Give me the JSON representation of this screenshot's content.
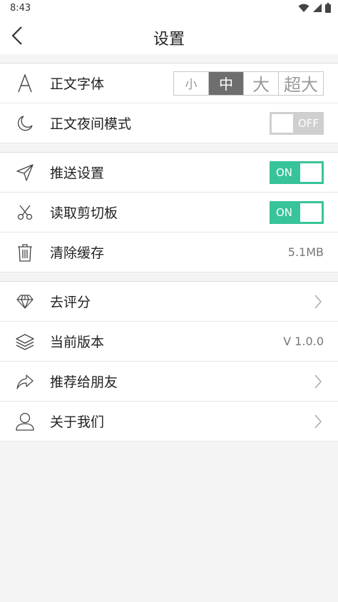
{
  "status_bar": {
    "time": "8:43",
    "icons": [
      "wifi-icon",
      "signal-icon",
      "battery-icon"
    ]
  },
  "header": {
    "title": "设置",
    "back_icon": "chevron-left-icon"
  },
  "colors": {
    "accent": "#38c49a",
    "toggle_off": "#cfcfcf",
    "segment_active": "#6e6e6e"
  },
  "groups": [
    {
      "items": [
        {
          "icon": "font-a-icon",
          "label": "正文字体",
          "control": "segment",
          "options": [
            "小",
            "中",
            "大",
            "超大"
          ],
          "selected": "中"
        },
        {
          "icon": "moon-icon",
          "label": "正文夜间模式",
          "control": "toggle",
          "state": "OFF"
        }
      ]
    },
    {
      "items": [
        {
          "icon": "send-arrow-icon",
          "label": "推送设置",
          "control": "toggle",
          "state": "ON"
        },
        {
          "icon": "scissors-icon",
          "label": "读取剪切板",
          "control": "toggle",
          "state": "ON"
        },
        {
          "icon": "trash-icon",
          "label": "清除缓存",
          "control": "value",
          "value": "5.1MB"
        }
      ]
    },
    {
      "items": [
        {
          "icon": "diamond-icon",
          "label": "去评分",
          "control": "chevron"
        },
        {
          "icon": "layers-icon",
          "label": "当前版本",
          "control": "value",
          "value": "V 1.0.0"
        },
        {
          "icon": "share-arrow-icon",
          "label": "推荐给朋友",
          "control": "chevron"
        },
        {
          "icon": "user-icon",
          "label": "关于我们",
          "control": "chevron"
        }
      ]
    }
  ]
}
